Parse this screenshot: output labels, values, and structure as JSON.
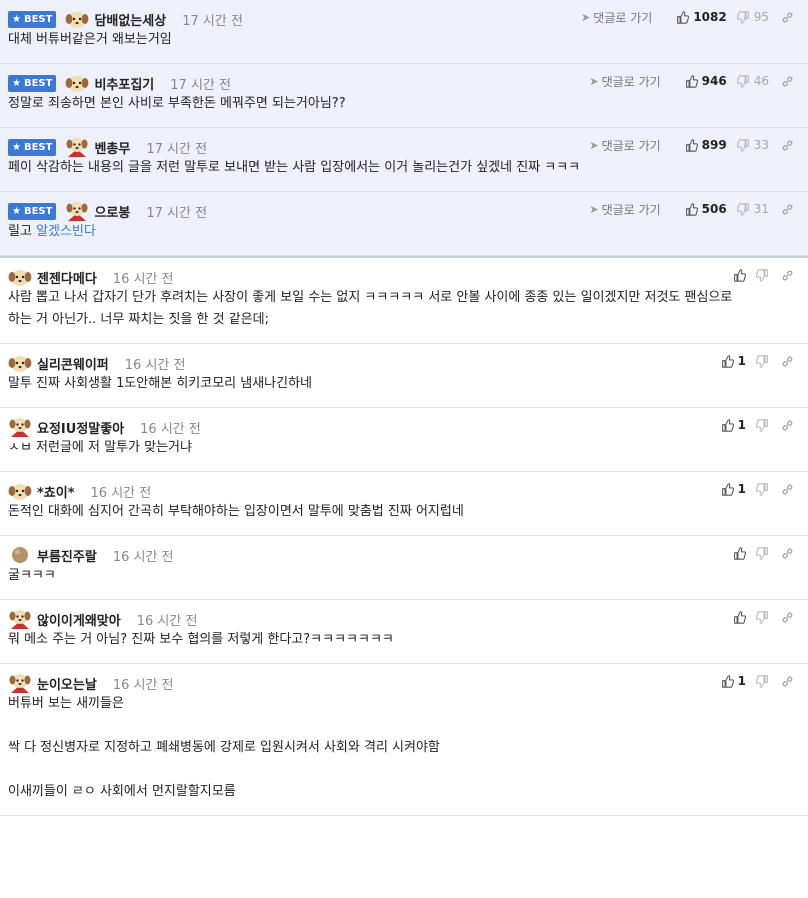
{
  "best_badge": "BEST",
  "reply_link_label": "댓글로 가기",
  "comments": [
    {
      "best": true,
      "nick": "담배없는세상",
      "time": "17 시간 전",
      "up": "1082",
      "down": "95",
      "lines": [
        "대체 버튜버같은거 왜보는거임"
      ],
      "avatar": "dog"
    },
    {
      "best": true,
      "nick": "비추포집기",
      "time": "17 시간 전",
      "up": "946",
      "down": "46",
      "lines": [
        "정말로 죄송하면 본인 사비로 부족한돈 메꿔주면 되는거아님??"
      ],
      "avatar": "dog"
    },
    {
      "best": true,
      "nick": "벤총무",
      "time": "17 시간 전",
      "up": "899",
      "down": "33",
      "lines": [
        "페이 삭감하는 내용의 글을 저런 말투로 보내면 받는 사람 입장에서는 이거 놀리는건가 싶겠네 진짜 ㅋㅋㅋ"
      ],
      "avatar": "cape"
    },
    {
      "best": true,
      "nick": "으로봉",
      "time": "17 시간 전",
      "up": "506",
      "down": "31",
      "lines_pre": "릴고 ",
      "lines_hl": "알겠스빈다",
      "avatar": "cape"
    },
    {
      "best": false,
      "nick": "젠젠다메다",
      "time": "16 시간 전",
      "up": "",
      "down": "",
      "lines": [
        "사람 뽑고 나서 갑자기 단가 후려치는 사장이 좋게 보일 수는 없지 ㅋㅋㅋㅋㅋ 서로 안볼 사이에 종종 있는 일이겠지만 저것도 팬심으로",
        "하는 거 아닌가.. 너무 짜치는 짓을 한 것 같은데;"
      ],
      "avatar": "dog"
    },
    {
      "best": false,
      "nick": "실리콘웨이퍼",
      "time": "16 시간 전",
      "up": "1",
      "down": "",
      "lines": [
        "말투 진짜 사회생활 1도안해본 히키코모리 냄새나긴하네"
      ],
      "avatar": "dog"
    },
    {
      "best": false,
      "nick": "요정IU정말좋아",
      "time": "16 시간 전",
      "up": "1",
      "down": "",
      "lines": [
        "ㅅㅂ 저런글에 저 말투가 맞는거냐"
      ],
      "avatar": "cape"
    },
    {
      "best": false,
      "nick": "*쵸이*",
      "time": "16 시간 전",
      "up": "1",
      "down": "",
      "lines": [
        "돈적인 대화에 심지어 간곡히 부탁해야하는 입장이면서 말투에 맞춤법 진짜 어지럽네"
      ],
      "avatar": "dog"
    },
    {
      "best": false,
      "nick": "부름진주랄",
      "time": "16 시간 전",
      "up": "",
      "down": "",
      "lines": [
        "굴ㅋㅋㅋ"
      ],
      "avatar": "ball"
    },
    {
      "best": false,
      "nick": "않이이게왜맞아",
      "time": "16 시간 전",
      "up": "",
      "down": "",
      "lines": [
        "뭐 메소 주는 거 아님? 진짜 보수 협의를 저렇게 한다고?ㅋㅋㅋㅋㅋㅋㅋ"
      ],
      "avatar": "cape"
    },
    {
      "best": false,
      "nick": "눈이오는날",
      "time": "16 시간 전",
      "up": "1",
      "down": "",
      "lines": [
        "버튜버 보는 새끼들은",
        "",
        "싹 다 정신병자로 지정하고 폐쇄병동에 강제로 입원시켜서 사회와 격리 시켜야함",
        "",
        "이새끼들이 ㄹㅇ 사회에서 먼지랄할지모름"
      ],
      "avatar": "cape"
    }
  ]
}
